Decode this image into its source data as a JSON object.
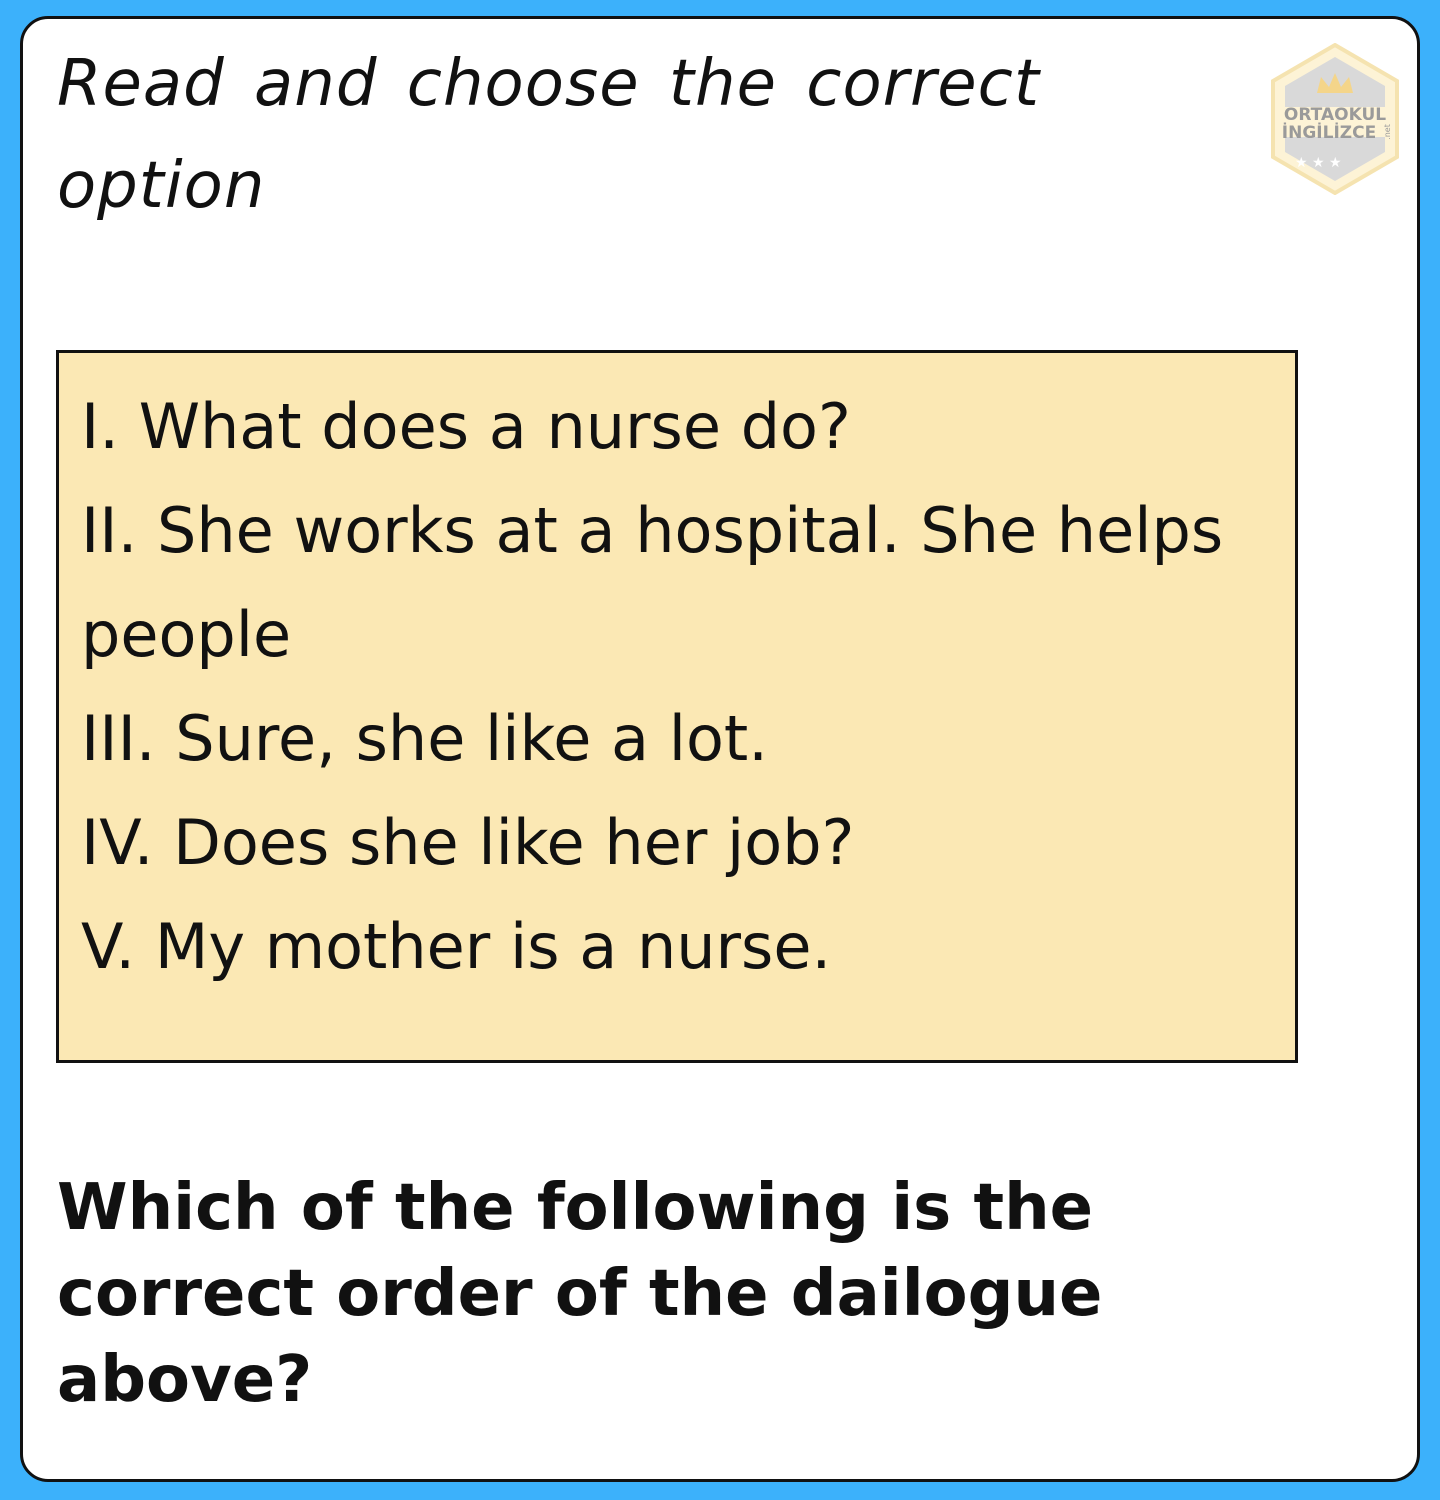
{
  "instruction": "Read and choose the correct option",
  "logo": {
    "line1": "ORTAOKUL",
    "line2": "İNGİLİZCE",
    "suffix": ".net",
    "icon": "crown-icon"
  },
  "dialogue": [
    "I. What does a nurse do?",
    "II. She works at a hospital. She helps people",
    "III. Sure, she like a lot.",
    "IV. Does she like her job?",
    "V. My mother is a nurse."
  ],
  "question": "Which of the following is the correct order of the dailogue above?",
  "colors": {
    "background": "#3cb1fb",
    "card": "#ffffff",
    "dialogue_box": "#fbe8b4",
    "text": "#111111"
  }
}
